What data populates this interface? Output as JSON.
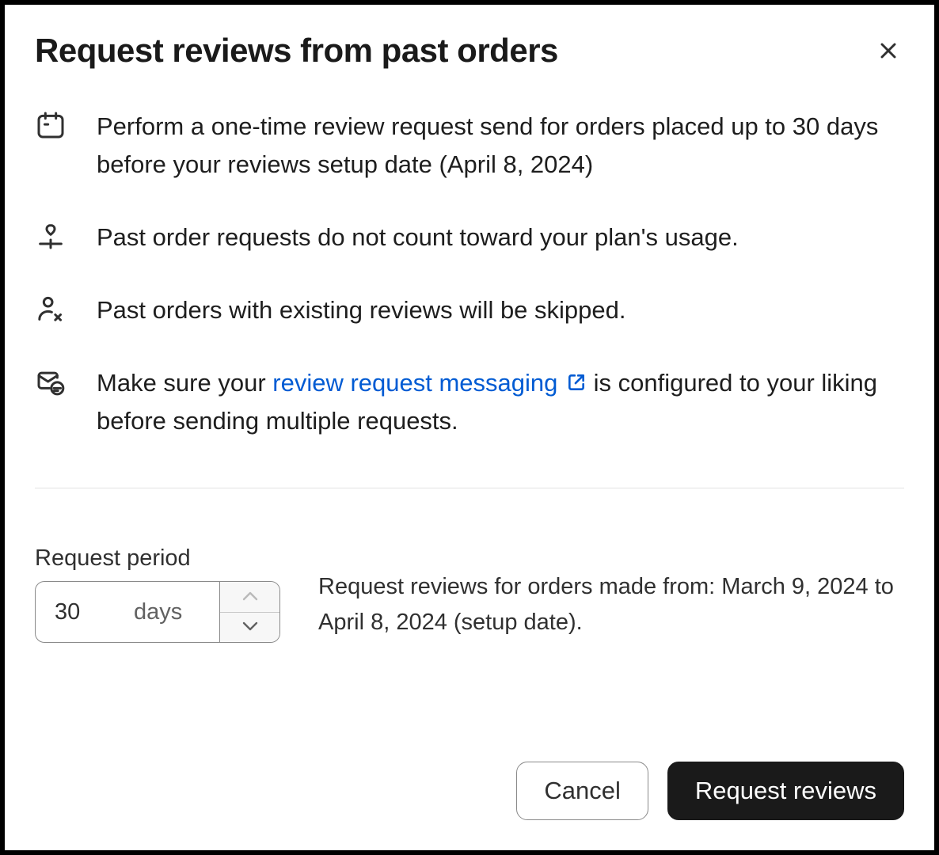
{
  "title": "Request reviews from past orders",
  "info": {
    "item1": "Perform a one-time review request send for orders placed up to 30 days before your reviews setup date (April 8, 2024)",
    "item2": "Past order requests do not count toward your plan's usage.",
    "item3": "Past orders with existing reviews will be skipped.",
    "item4_pre": "Make sure your ",
    "item4_link": "review request messaging",
    "item4_post": " is configured to your liking before sending multiple requests."
  },
  "form": {
    "label": "Request period",
    "value": "30",
    "suffix": "days",
    "description": "Request reviews for orders made from: March 9, 2024 to April 8, 2024 (setup date)."
  },
  "buttons": {
    "cancel": "Cancel",
    "submit": "Request reviews"
  }
}
